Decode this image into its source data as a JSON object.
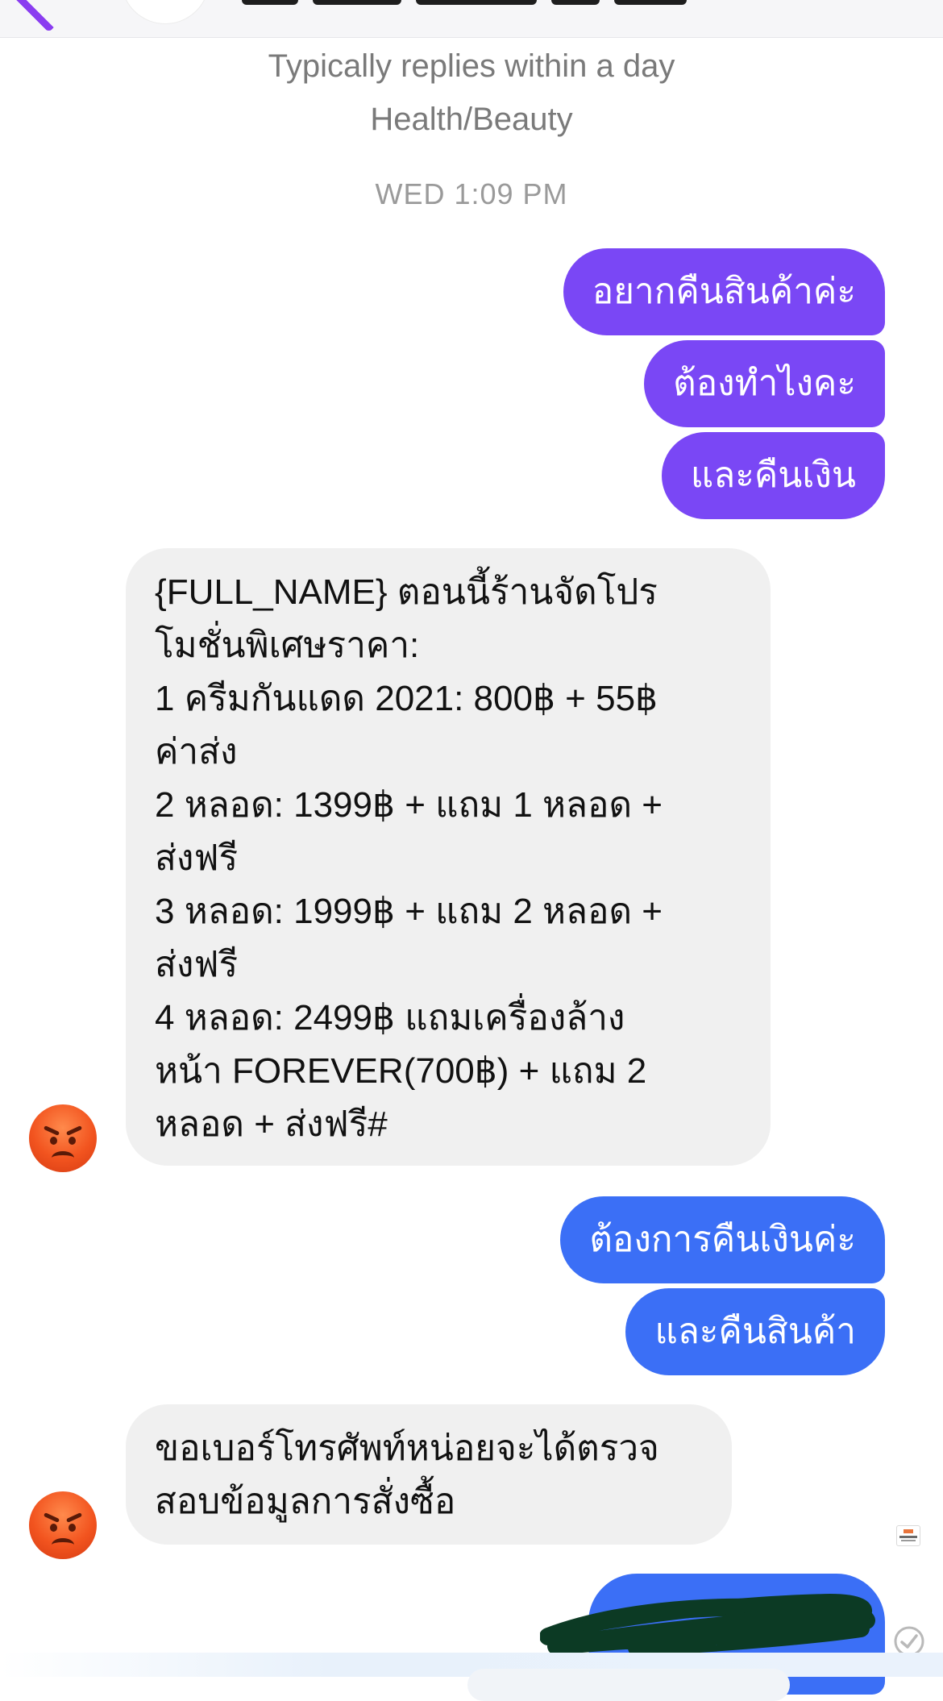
{
  "header": {
    "replies_note": "Typically replies within a day",
    "category": "Health/Beauty"
  },
  "timestamp": "WED 1:09 PM",
  "messages": {
    "outgoing_1": [
      "อยากคืนสินค้าค่ะ",
      "ต้องทำไงคะ",
      "และคืนเงิน"
    ],
    "incoming_1": [
      "{FULL_NAME}  ตอนนี้ร้านจัดโปร",
      "โมชั่นพิเศษราคา:",
      "1 ครีมกันแดด 2021: 800฿ + 55฿",
      "ค่าส่ง",
      "2 หลอด: 1399฿ + แถม 1 หลอด +",
      "ส่งฟรี",
      "3 หลอด: 1999฿ + แถม 2 หลอด +",
      "ส่งฟรี",
      "4 หลอด: 2499฿ แถมเครื่องล้าง",
      "หน้า FOREVER(700฿) + แถม 2",
      "หลอด + ส่งฟรี#"
    ],
    "outgoing_2": [
      "ต้องการคืนเงินค่ะ",
      "และคืนสินค้า"
    ],
    "incoming_2": [
      "ขอเบอร์โทรศัพท์หน่อยจะได้ตรวจ",
      "สอบข้อมูลการสั่งซื้อ"
    ]
  },
  "colors": {
    "outgoing_purple": "#7a47f5",
    "outgoing_blue": "#3b6ff6",
    "incoming_bg": "#f0f0f0",
    "accent": "#8a3df0"
  },
  "icons": {
    "back": "chevron-left-icon",
    "sender_avatar": "angry-face-emoji",
    "seen": "page-logo-seen-icon",
    "delivered": "check-circle-icon"
  }
}
